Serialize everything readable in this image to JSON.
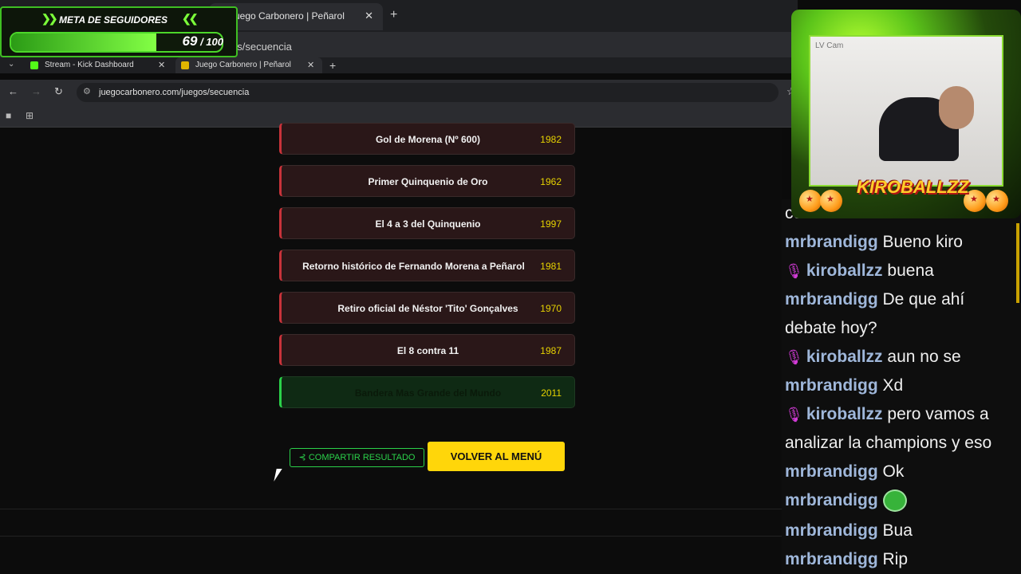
{
  "outer_browser": {
    "tab_title": "Juego Carbonero | Peñarol",
    "url_fragment": "os/secuencia"
  },
  "follower_goal": {
    "title": "META DE SEGUIDORES",
    "current": "69",
    "separator": " / ",
    "goal": "100",
    "progress_fraction": 0.69
  },
  "inner_browser": {
    "tabs": [
      {
        "title": "Stream - Kick Dashboard",
        "icon": "kick-icon",
        "active": false
      },
      {
        "title": "Juego Carbonero | Peñarol",
        "icon": "favicon",
        "active": true
      }
    ],
    "url": "juegocarbonero.com/juegos/secuencia"
  },
  "sequence": [
    {
      "event": "Gol de Morena (Nº 600)",
      "year": "1982",
      "status": "incorrect"
    },
    {
      "event": "Primer Quinquenio de Oro",
      "year": "1962",
      "status": "incorrect"
    },
    {
      "event": "El 4 a 3 del Quinquenio",
      "year": "1997",
      "status": "incorrect"
    },
    {
      "event": "Retorno histórico de Fernando Morena a Peñarol",
      "year": "1981",
      "status": "incorrect"
    },
    {
      "event": "Retiro oficial de Néstor 'Tito' Gonçalves",
      "year": "1970",
      "status": "incorrect"
    },
    {
      "event": "El 8 contra 11",
      "year": "1987",
      "status": "incorrect"
    },
    {
      "event": "Bandera Mas Grande del Mundo",
      "year": "2011",
      "status": "correct"
    }
  ],
  "actions": {
    "share_label": "COMPARTIR RESULTADO",
    "menu_label": "VOLVER AL MENÚ"
  },
  "webcam": {
    "label": "LV Cam",
    "logo": "KIROBALLZZ"
  },
  "chat": [
    {
      "user": "",
      "text": "comenzamos",
      "mod": false
    },
    {
      "user": "mrbrandigg",
      "text": "Bueno kiro",
      "mod": false
    },
    {
      "user": "kiroballzz",
      "text": "buena",
      "mod": true
    },
    {
      "user": "mrbrandigg",
      "text": "De que ahí",
      "mod": false
    },
    {
      "user": "",
      "text": "debate hoy?",
      "mod": false
    },
    {
      "user": "kiroballzz",
      "text": "aun no se",
      "mod": true
    },
    {
      "user": "mrbrandigg",
      "text": "Xd",
      "mod": false
    },
    {
      "user": "kiroballzz",
      "text": "pero vamos a",
      "mod": true
    },
    {
      "user": "",
      "text": "analizar la champions y eso",
      "mod": false
    },
    {
      "user": "mrbrandigg",
      "text": "Ok",
      "mod": false
    },
    {
      "user": "mrbrandigg",
      "text": "",
      "mod": false,
      "emote": "frog-emote"
    },
    {
      "user": "mrbrandigg",
      "text": "Bua",
      "mod": false
    },
    {
      "user": "mrbrandigg",
      "text": "Rip",
      "mod": false
    }
  ],
  "colors": {
    "accent_green": "#2bd14a",
    "accent_yellow": "#ffd60a",
    "incorrect_red": "#c8333a",
    "year_yellow": "#e6d200"
  }
}
